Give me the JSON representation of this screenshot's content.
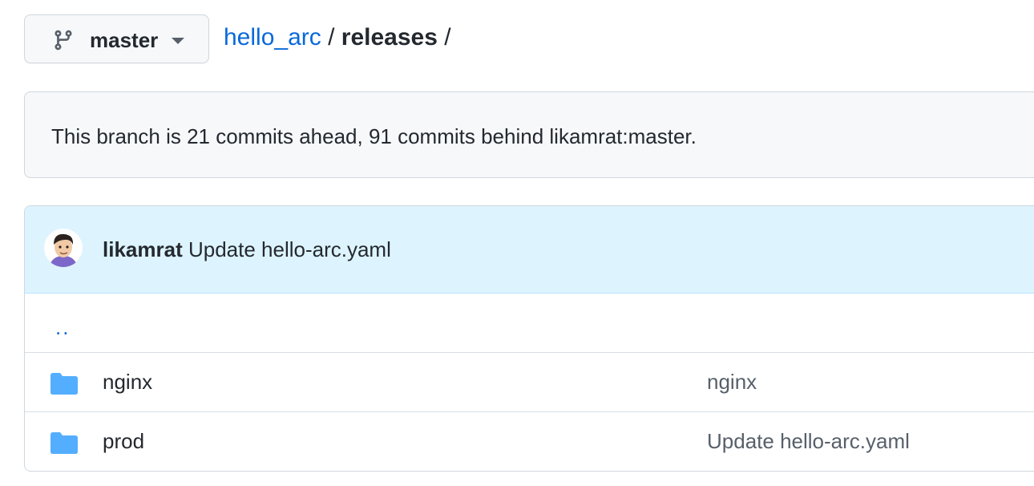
{
  "branch_selector": {
    "label": "master"
  },
  "breadcrumb": {
    "repo": "hello_arc",
    "separator": "/",
    "current": "releases",
    "trailing_separator": "/"
  },
  "branch_status": {
    "text": "This branch is 21 commits ahead, 91 commits behind likamrat:master."
  },
  "latest_commit": {
    "author": "likamrat",
    "message": "Update hello-arc.yaml"
  },
  "parent_link": "..",
  "files": [
    {
      "name": "nginx",
      "type": "folder",
      "commit_message": "nginx"
    },
    {
      "name": "prod",
      "type": "folder",
      "commit_message": "Update hello-arc.yaml"
    }
  ],
  "colors": {
    "link": "#0969da",
    "folder": "#54aeff",
    "commit_row_bg": "#ddf4ff"
  }
}
